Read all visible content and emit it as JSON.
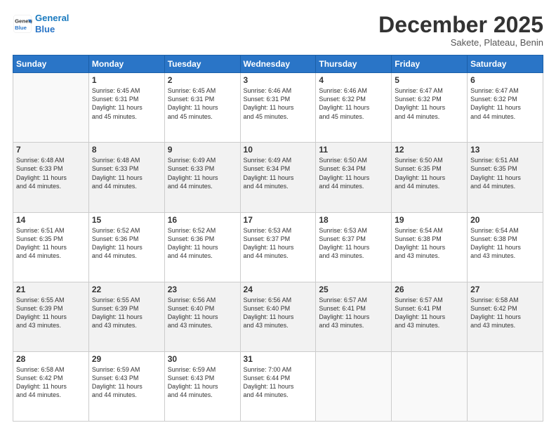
{
  "header": {
    "logo_line1": "General",
    "logo_line2": "Blue",
    "month": "December 2025",
    "location": "Sakete, Plateau, Benin"
  },
  "days_of_week": [
    "Sunday",
    "Monday",
    "Tuesday",
    "Wednesday",
    "Thursday",
    "Friday",
    "Saturday"
  ],
  "weeks": [
    [
      {
        "day": "",
        "info": ""
      },
      {
        "day": "1",
        "info": "Sunrise: 6:45 AM\nSunset: 6:31 PM\nDaylight: 11 hours\nand 45 minutes."
      },
      {
        "day": "2",
        "info": "Sunrise: 6:45 AM\nSunset: 6:31 PM\nDaylight: 11 hours\nand 45 minutes."
      },
      {
        "day": "3",
        "info": "Sunrise: 6:46 AM\nSunset: 6:31 PM\nDaylight: 11 hours\nand 45 minutes."
      },
      {
        "day": "4",
        "info": "Sunrise: 6:46 AM\nSunset: 6:32 PM\nDaylight: 11 hours\nand 45 minutes."
      },
      {
        "day": "5",
        "info": "Sunrise: 6:47 AM\nSunset: 6:32 PM\nDaylight: 11 hours\nand 44 minutes."
      },
      {
        "day": "6",
        "info": "Sunrise: 6:47 AM\nSunset: 6:32 PM\nDaylight: 11 hours\nand 44 minutes."
      }
    ],
    [
      {
        "day": "7",
        "info": "Sunrise: 6:48 AM\nSunset: 6:33 PM\nDaylight: 11 hours\nand 44 minutes."
      },
      {
        "day": "8",
        "info": "Sunrise: 6:48 AM\nSunset: 6:33 PM\nDaylight: 11 hours\nand 44 minutes."
      },
      {
        "day": "9",
        "info": "Sunrise: 6:49 AM\nSunset: 6:33 PM\nDaylight: 11 hours\nand 44 minutes."
      },
      {
        "day": "10",
        "info": "Sunrise: 6:49 AM\nSunset: 6:34 PM\nDaylight: 11 hours\nand 44 minutes."
      },
      {
        "day": "11",
        "info": "Sunrise: 6:50 AM\nSunset: 6:34 PM\nDaylight: 11 hours\nand 44 minutes."
      },
      {
        "day": "12",
        "info": "Sunrise: 6:50 AM\nSunset: 6:35 PM\nDaylight: 11 hours\nand 44 minutes."
      },
      {
        "day": "13",
        "info": "Sunrise: 6:51 AM\nSunset: 6:35 PM\nDaylight: 11 hours\nand 44 minutes."
      }
    ],
    [
      {
        "day": "14",
        "info": "Sunrise: 6:51 AM\nSunset: 6:35 PM\nDaylight: 11 hours\nand 44 minutes."
      },
      {
        "day": "15",
        "info": "Sunrise: 6:52 AM\nSunset: 6:36 PM\nDaylight: 11 hours\nand 44 minutes."
      },
      {
        "day": "16",
        "info": "Sunrise: 6:52 AM\nSunset: 6:36 PM\nDaylight: 11 hours\nand 44 minutes."
      },
      {
        "day": "17",
        "info": "Sunrise: 6:53 AM\nSunset: 6:37 PM\nDaylight: 11 hours\nand 44 minutes."
      },
      {
        "day": "18",
        "info": "Sunrise: 6:53 AM\nSunset: 6:37 PM\nDaylight: 11 hours\nand 43 minutes."
      },
      {
        "day": "19",
        "info": "Sunrise: 6:54 AM\nSunset: 6:38 PM\nDaylight: 11 hours\nand 43 minutes."
      },
      {
        "day": "20",
        "info": "Sunrise: 6:54 AM\nSunset: 6:38 PM\nDaylight: 11 hours\nand 43 minutes."
      }
    ],
    [
      {
        "day": "21",
        "info": "Sunrise: 6:55 AM\nSunset: 6:39 PM\nDaylight: 11 hours\nand 43 minutes."
      },
      {
        "day": "22",
        "info": "Sunrise: 6:55 AM\nSunset: 6:39 PM\nDaylight: 11 hours\nand 43 minutes."
      },
      {
        "day": "23",
        "info": "Sunrise: 6:56 AM\nSunset: 6:40 PM\nDaylight: 11 hours\nand 43 minutes."
      },
      {
        "day": "24",
        "info": "Sunrise: 6:56 AM\nSunset: 6:40 PM\nDaylight: 11 hours\nand 43 minutes."
      },
      {
        "day": "25",
        "info": "Sunrise: 6:57 AM\nSunset: 6:41 PM\nDaylight: 11 hours\nand 43 minutes."
      },
      {
        "day": "26",
        "info": "Sunrise: 6:57 AM\nSunset: 6:41 PM\nDaylight: 11 hours\nand 43 minutes."
      },
      {
        "day": "27",
        "info": "Sunrise: 6:58 AM\nSunset: 6:42 PM\nDaylight: 11 hours\nand 43 minutes."
      }
    ],
    [
      {
        "day": "28",
        "info": "Sunrise: 6:58 AM\nSunset: 6:42 PM\nDaylight: 11 hours\nand 44 minutes."
      },
      {
        "day": "29",
        "info": "Sunrise: 6:59 AM\nSunset: 6:43 PM\nDaylight: 11 hours\nand 44 minutes."
      },
      {
        "day": "30",
        "info": "Sunrise: 6:59 AM\nSunset: 6:43 PM\nDaylight: 11 hours\nand 44 minutes."
      },
      {
        "day": "31",
        "info": "Sunrise: 7:00 AM\nSunset: 6:44 PM\nDaylight: 11 hours\nand 44 minutes."
      },
      {
        "day": "",
        "info": ""
      },
      {
        "day": "",
        "info": ""
      },
      {
        "day": "",
        "info": ""
      }
    ]
  ]
}
